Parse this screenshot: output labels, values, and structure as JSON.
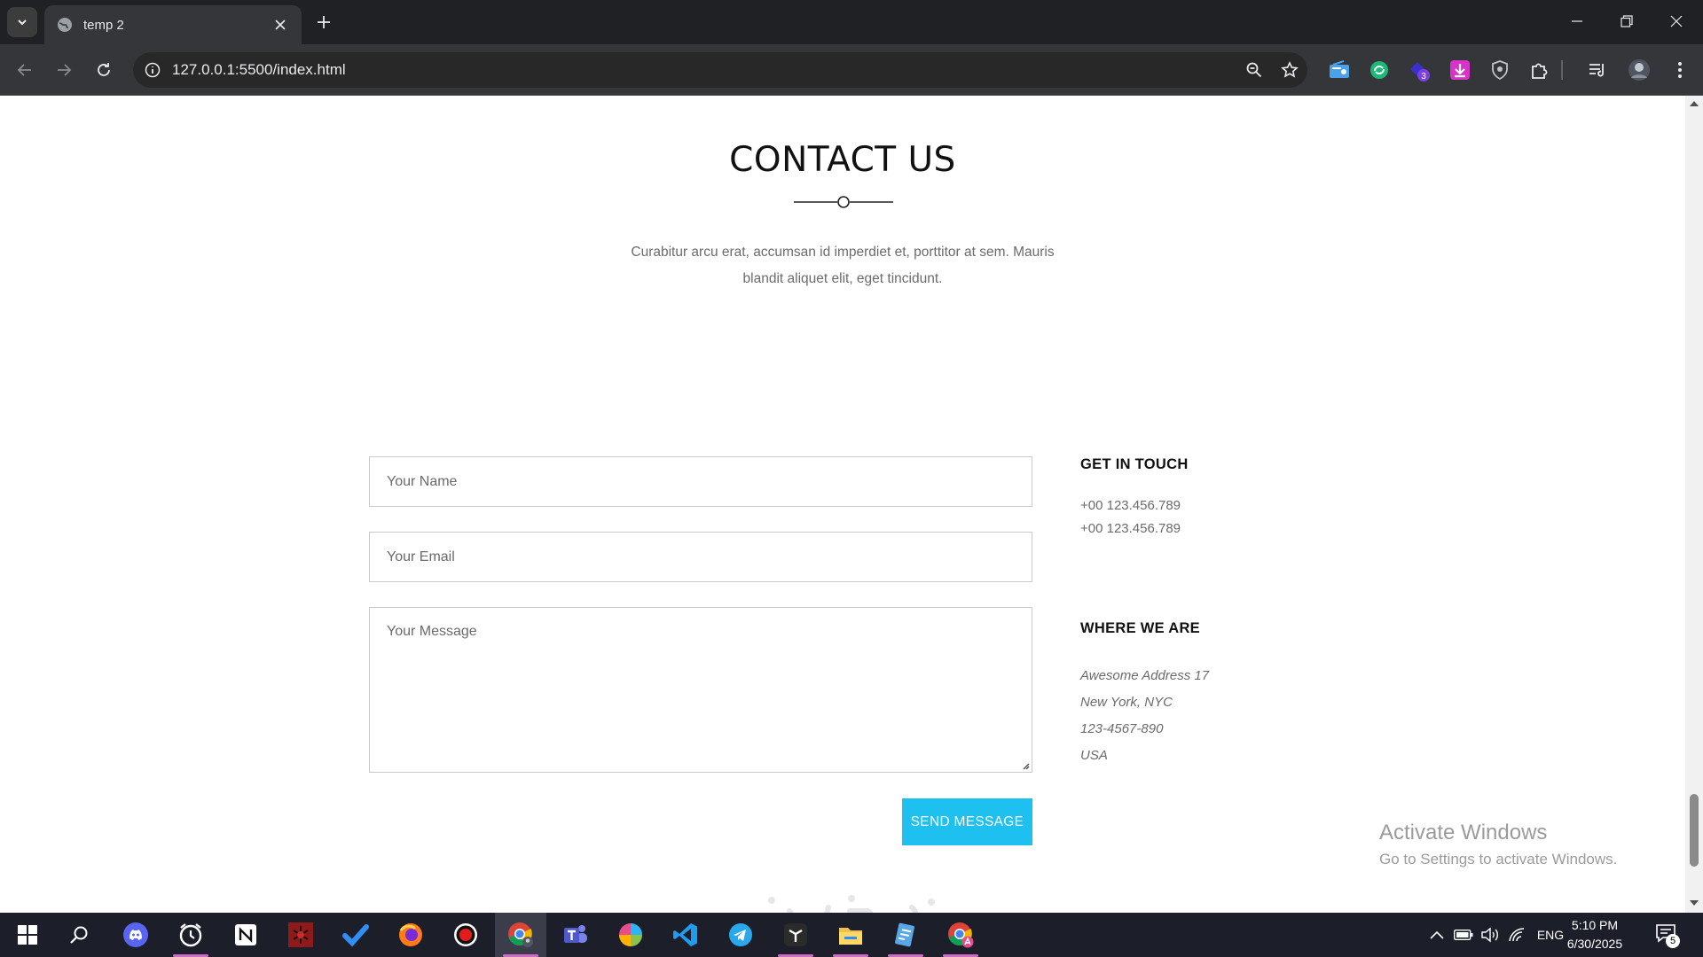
{
  "browser": {
    "tab_title": "temp 2",
    "url": "127.0.0.1:5500/index.html",
    "extension_badge": "3"
  },
  "page": {
    "heading": "CONTACT US",
    "intro": "Curabitur arcu erat, accumsan id imperdiet et, porttitor at sem. Mauris blandit aliquet elit, eget tincidunt.",
    "form": {
      "name_placeholder": "Your Name",
      "email_placeholder": "Your Email",
      "message_placeholder": "Your Message",
      "send_label": "SEND MESSAGE"
    },
    "get_in_touch": {
      "title": "GET IN TOUCH",
      "phone_1": "+00 123.456.789",
      "phone_2": "+00 123.456.789"
    },
    "where_we_are": {
      "title": "WHERE WE ARE",
      "line_1": "Awesome Address 17",
      "line_2": "New York, NYC",
      "line_3": "123-4567-890",
      "line_4": "USA"
    },
    "accent_color": "#1ec0f0"
  },
  "watermark": {
    "title": "Activate Windows",
    "subtitle": "Go to Settings to activate Windows."
  },
  "taskbar": {
    "language": "ENG",
    "time": "5:10 PM",
    "date": "6/30/2025",
    "notification_count": "5",
    "apps": [
      "start-icon",
      "search-icon",
      "discord-icon",
      "alarms-icon",
      "notion-icon",
      "spiderman-icon",
      "todo-icon",
      "firefox-icon",
      "recorder-icon",
      "chrome-icon",
      "teams-icon",
      "chart-app-icon",
      "vscode-icon",
      "telegram-icon",
      "app-icon",
      "file-explorer-icon",
      "notes-icon",
      "chrome-profile-icon"
    ]
  }
}
